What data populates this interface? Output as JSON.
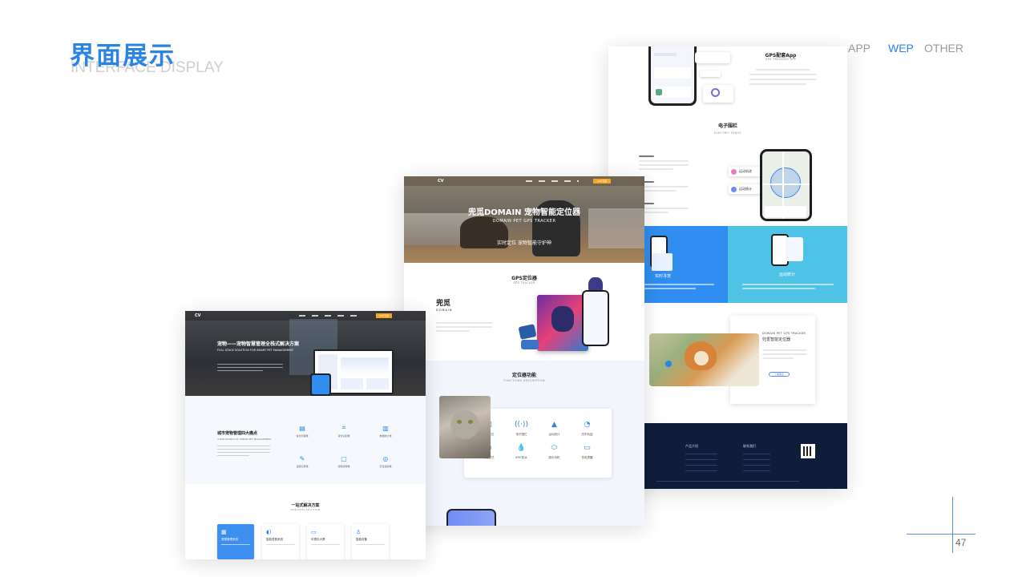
{
  "header": {
    "title_cn": "界面展示",
    "title_en": "INTERFACE DISPLAY"
  },
  "nav": {
    "items": [
      {
        "label": "APP",
        "active": false
      },
      {
        "label": "WEP",
        "active": true
      },
      {
        "label": "OTHER",
        "active": false
      }
    ]
  },
  "page_number": "47",
  "colors": {
    "accent": "#2a84e6",
    "dark_navy": "#0e1d3a",
    "cyan": "#4fc3e6",
    "blue": "#2f8ef0"
  },
  "mock_left": {
    "nav_button": "APP下载",
    "hero_cn": "宠物——宠物智慧管理全栈式解决方案",
    "hero_en": "FULL STACK SOLUTION FOR SMART PET MANAGEMENT",
    "pain_title": "城市宠物管理四大痛点",
    "pain_en": "4 PAIN POINTS OF URBAN PET MANAGEMENT",
    "icons": [
      {
        "name": "doc-icon",
        "label": "信息管理难"
      },
      {
        "name": "scan-icon",
        "label": "身份识别难"
      },
      {
        "name": "chart-icon",
        "label": "数据统计难"
      },
      {
        "name": "edit-icon",
        "label": "违规记录难"
      },
      {
        "name": "device-icon",
        "label": "智能终端难"
      },
      {
        "name": "target-icon",
        "label": "定位追踪难"
      }
    ],
    "solution_cn": "一站式解决方案",
    "solution_en": "ONE-STOP SOLUTION",
    "cards": [
      "宠物管理系统",
      "智能语音系统",
      "可视化大屏",
      "智能设备"
    ]
  },
  "mock_mid": {
    "hero_cn": "兜觅DOMAIN 宠物智能定位器",
    "hero_en": "DOMAIN PET GPS TRACKER",
    "hero_sub": "实时定位 宠物智能守护神",
    "nav_button": "APP下载",
    "gps_cn": "GPS定位器",
    "gps_en": "GPS TRACKER",
    "brand": "兜觅",
    "brand_en": "DOMAIN",
    "func_cn": "定位器功能",
    "func_en": "FUNCTIONS DESCRIPTION",
    "funcs": [
      "实时定位",
      "电子围栏",
      "运动统计",
      "历史轨迹",
      "寻宠模式",
      "IP67防水",
      "超长待机",
      "低电提醒"
    ]
  },
  "mock_right": {
    "app_title": "GPS配套App",
    "app_en": "GPS TRACKING APP",
    "fence_cn": "电子围栏",
    "fence_en": "ELECTRIC FENCE",
    "pill_a": "运动轨迹",
    "pill_b": "运动统计",
    "panel_a": "实时寻宠",
    "panel_b": "运动统计",
    "product_en": "DOMAIN PET GPS TRACKER",
    "product_cn": "兜觅智能定位器",
    "product_btn": "了解更多",
    "footer_cols": [
      "产品介绍",
      "联系我们"
    ]
  }
}
